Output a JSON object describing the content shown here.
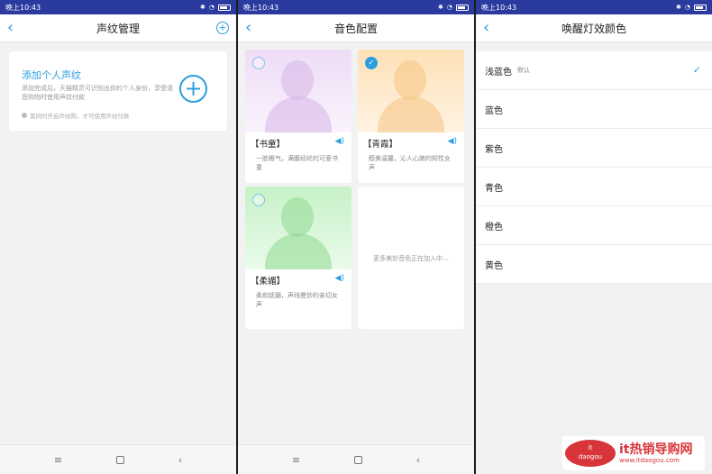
{
  "status": {
    "time": "晚上10:43",
    "batt": "▭"
  },
  "panel1": {
    "title": "声纹管理",
    "card_title": "添加个人声纹",
    "card_desc": "添加完成后，天猫精灵可识别出你的个人身份，享受语音购物时使用声纹付款",
    "card_note": "需同时开启声纹购，才可使用声纹付款"
  },
  "panel2": {
    "title": "音色配置",
    "voices": [
      {
        "name": "【书童】",
        "desc": "一脸稚气，满腹经纶的可爱书童",
        "selected": false
      },
      {
        "name": "【青霞】",
        "desc": "醇美温馨，沁人心脾的知性女声",
        "selected": true
      },
      {
        "name": "【柔媚】",
        "desc": "柔和妩媚，声线曼妙的亲切女声",
        "selected": false
      }
    ],
    "more_text": "更多美妙音色正在加入中..."
  },
  "panel3": {
    "title": "唤醒灯效颜色",
    "colors": [
      {
        "label": "浅蓝色",
        "tag": "默认",
        "selected": true
      },
      {
        "label": "蓝色"
      },
      {
        "label": "紫色"
      },
      {
        "label": "青色"
      },
      {
        "label": "橙色"
      },
      {
        "label": "黄色"
      }
    ]
  },
  "watermark": {
    "logo_it": "it",
    "logo_sub": "daogou",
    "title": "it热销导购网",
    "url": "www.itdaogou.com"
  },
  "colors": {
    "accent": "#2a9fe0",
    "statusbar": "#2a3a9e",
    "watermark": "#d8353a"
  }
}
